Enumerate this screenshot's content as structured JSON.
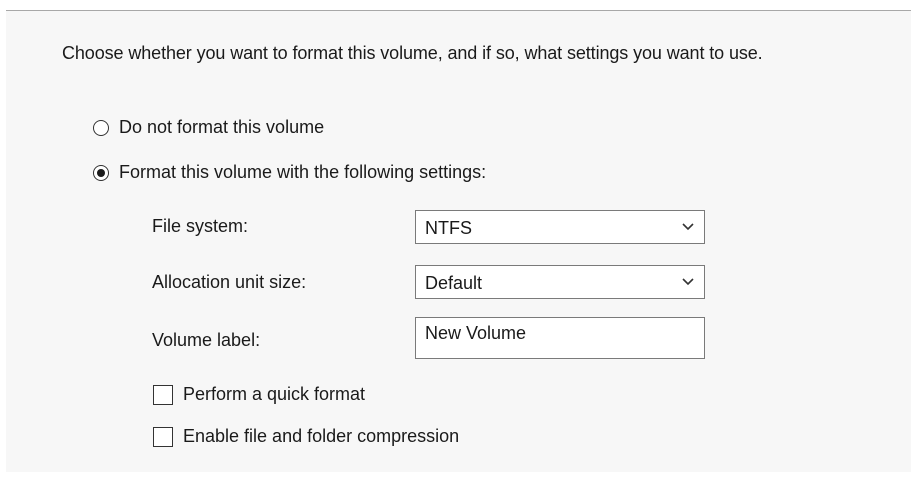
{
  "intro_text": "Choose whether you want to format this volume, and if so, what settings you want to use.",
  "options": {
    "do_not_format": {
      "label": "Do not format this volume",
      "selected": false
    },
    "format_with_settings": {
      "label": "Format this volume with the following settings:",
      "selected": true
    }
  },
  "settings": {
    "file_system": {
      "label": "File system:",
      "value": "NTFS"
    },
    "allocation_unit_size": {
      "label": "Allocation unit size:",
      "value": "Default"
    },
    "volume_label": {
      "label": "Volume label:",
      "value": "New Volume"
    }
  },
  "checkboxes": {
    "quick_format": {
      "label": "Perform a quick format",
      "checked": false
    },
    "compression": {
      "label": "Enable file and folder compression",
      "checked": false
    }
  },
  "icons": {
    "dropdown": "chevron-down-icon"
  }
}
